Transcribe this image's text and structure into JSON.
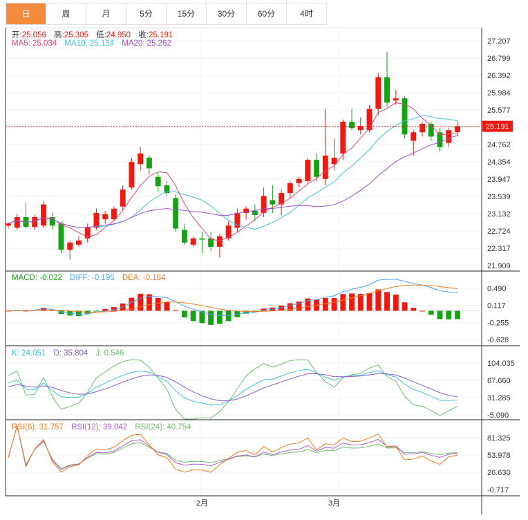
{
  "tabs": [
    "日",
    "周",
    "月",
    "5分",
    "15分",
    "30分",
    "60分",
    "4时"
  ],
  "active_tab": 0,
  "ohlc": {
    "open_label": "开:",
    "open": "25.056",
    "high_label": "高:",
    "high": "25.305",
    "low_label": "低:",
    "low": "24.950",
    "close_label": "收:",
    "close": "25.191"
  },
  "ma": {
    "ma5": "MA5: 25.034",
    "ma10": "MA10: 25.134",
    "ma20": "MA20: 25.262"
  },
  "macd": {
    "macd": "MACD: -0.022",
    "diff": "DIFF: -0.195",
    "dea": "DEA: -0.184"
  },
  "kdj": {
    "k": "K: 24.051",
    "d": "D: 35.804",
    "j": "J: 0.546"
  },
  "rsi": {
    "rsi6": "RSI(6): 31.757",
    "rsi12": "RSI(12): 39.042",
    "rsi24": "RSI(24): 40.754"
  },
  "colors": {
    "up": "#f0190f",
    "down": "#13a313",
    "ma5": "#e8447a",
    "ma10": "#3cc3dc",
    "ma20": "#a04fc8",
    "accent": "#f28c3c"
  },
  "chart_data": {
    "type": "candlestick",
    "price_ticks": [
      "27.207",
      "26.799",
      "26.392",
      "25.984",
      "25.577",
      "25.169",
      "24.762",
      "24.354",
      "23.947",
      "23.539",
      "23.132",
      "22.724",
      "22.317",
      "21.909"
    ],
    "price_range": [
      21.909,
      27.207
    ],
    "current_price": "25.191",
    "macd_ticks": [
      "0.490",
      "0.117",
      "-0.255",
      "-0.628"
    ],
    "kdj_ticks": [
      "104.035",
      "67.660",
      "31.285",
      "-5.090"
    ],
    "rsi_ticks": [
      "81.325",
      "53.978",
      "26.630",
      "-0.717"
    ],
    "x_labels": [
      {
        "index": 22,
        "label": "2月"
      },
      {
        "index": 37,
        "label": "3月"
      }
    ],
    "candles": [
      [
        22.85,
        22.92,
        22.78,
        22.9
      ],
      [
        22.8,
        23.12,
        22.75,
        23.05
      ],
      [
        23.05,
        23.4,
        22.78,
        22.82
      ],
      [
        22.82,
        23.1,
        22.75,
        23.05
      ],
      [
        22.85,
        23.42,
        22.8,
        23.35
      ],
      [
        23.05,
        23.15,
        22.75,
        22.85
      ],
      [
        22.9,
        22.95,
        22.2,
        22.28
      ],
      [
        22.28,
        22.5,
        22.05,
        22.45
      ],
      [
        22.4,
        22.6,
        22.35,
        22.5
      ],
      [
        22.55,
        22.9,
        22.45,
        22.82
      ],
      [
        22.8,
        23.25,
        22.75,
        23.15
      ],
      [
        23.0,
        23.2,
        22.9,
        23.12
      ],
      [
        23.0,
        23.3,
        22.95,
        23.25
      ],
      [
        23.3,
        23.8,
        23.2,
        23.7
      ],
      [
        23.75,
        24.45,
        23.7,
        24.35
      ],
      [
        24.3,
        24.7,
        24.15,
        24.55
      ],
      [
        24.45,
        24.5,
        24.05,
        24.2
      ],
      [
        24.0,
        24.1,
        23.65,
        23.78
      ],
      [
        23.8,
        23.9,
        23.55,
        23.62
      ],
      [
        23.5,
        23.6,
        22.7,
        22.78
      ],
      [
        22.75,
        22.9,
        22.4,
        22.45
      ],
      [
        22.4,
        22.6,
        22.35,
        22.55
      ],
      [
        22.55,
        22.7,
        22.2,
        22.52
      ],
      [
        22.55,
        22.7,
        22.25,
        22.35
      ],
      [
        22.35,
        22.65,
        22.1,
        22.6
      ],
      [
        22.55,
        22.95,
        22.5,
        22.85
      ],
      [
        22.8,
        23.25,
        22.7,
        23.15
      ],
      [
        23.15,
        23.3,
        23.0,
        23.25
      ],
      [
        23.2,
        23.35,
        22.95,
        23.1
      ],
      [
        23.15,
        23.75,
        23.05,
        23.55
      ],
      [
        23.45,
        23.8,
        23.15,
        23.35
      ],
      [
        23.35,
        23.7,
        23.1,
        23.62
      ],
      [
        23.62,
        23.9,
        23.5,
        23.85
      ],
      [
        23.85,
        24.0,
        23.75,
        23.95
      ],
      [
        23.9,
        24.45,
        23.85,
        24.4
      ],
      [
        24.4,
        24.55,
        23.9,
        24.0
      ],
      [
        23.95,
        25.6,
        23.8,
        24.5
      ],
      [
        24.3,
        24.9,
        24.15,
        24.45
      ],
      [
        24.55,
        25.35,
        24.4,
        25.3
      ],
      [
        25.3,
        25.6,
        25.1,
        25.15
      ],
      [
        25.1,
        25.4,
        25.0,
        25.2
      ],
      [
        25.1,
        25.7,
        25.05,
        25.6
      ],
      [
        25.6,
        26.45,
        25.45,
        26.35
      ],
      [
        26.35,
        26.95,
        25.65,
        25.75
      ],
      [
        25.8,
        26.05,
        25.7,
        25.85
      ],
      [
        25.85,
        25.9,
        24.9,
        25.0
      ],
      [
        24.85,
        25.1,
        24.5,
        25.05
      ],
      [
        25.05,
        25.3,
        24.95,
        25.25
      ],
      [
        25.25,
        25.3,
        24.85,
        24.95
      ],
      [
        25.05,
        25.15,
        24.6,
        24.7
      ],
      [
        24.8,
        25.15,
        24.7,
        25.1
      ],
      [
        25.056,
        25.305,
        24.95,
        25.191
      ]
    ]
  }
}
